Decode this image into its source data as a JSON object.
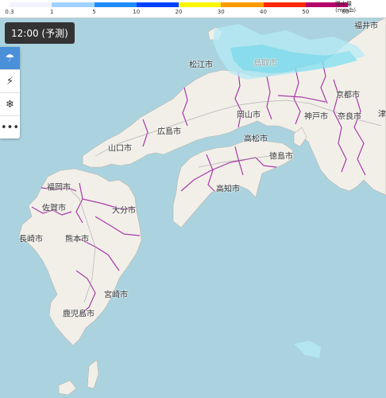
{
  "legend": {
    "ticks": [
      "0.3",
      "1",
      "5",
      "10",
      "20",
      "30",
      "40",
      "50",
      "80~"
    ],
    "unit_line1": "降水量",
    "unit_line2": "(mm/h)",
    "colors": [
      "#f2f2ff",
      "#a0d2ff",
      "#218cff",
      "#0041ff",
      "#faf500",
      "#ff9900",
      "#ff2800",
      "#b40068"
    ]
  },
  "time_label": "12:00 (予測)",
  "side_buttons": [
    {
      "name": "rain-icon",
      "glyph": "☂",
      "active": true
    },
    {
      "name": "lightning-icon",
      "glyph": "⚡",
      "active": false
    },
    {
      "name": "snow-icon",
      "glyph": "❄",
      "active": false
    },
    {
      "name": "more-icon",
      "glyph": "•••",
      "active": false
    }
  ],
  "cities": {
    "fukui": "福井市",
    "tottori": "鳥取市",
    "matsue": "松江市",
    "kyoto": "京都市",
    "kobe": "神戸市",
    "nara": "奈良市",
    "tsu": "津",
    "okayama": "岡山市",
    "hiroshima": "広島市",
    "takamatsu": "高松市",
    "yamaguchi": "山口市",
    "tokushima": "徳島市",
    "fukuoka": "福岡市",
    "kochi": "高知市",
    "saga": "佐賀市",
    "oita": "大分市",
    "nagasaki": "長崎市",
    "kumamoto": "熊本市",
    "miyazaki": "宮崎市",
    "kagoshima": "鹿児島市"
  }
}
